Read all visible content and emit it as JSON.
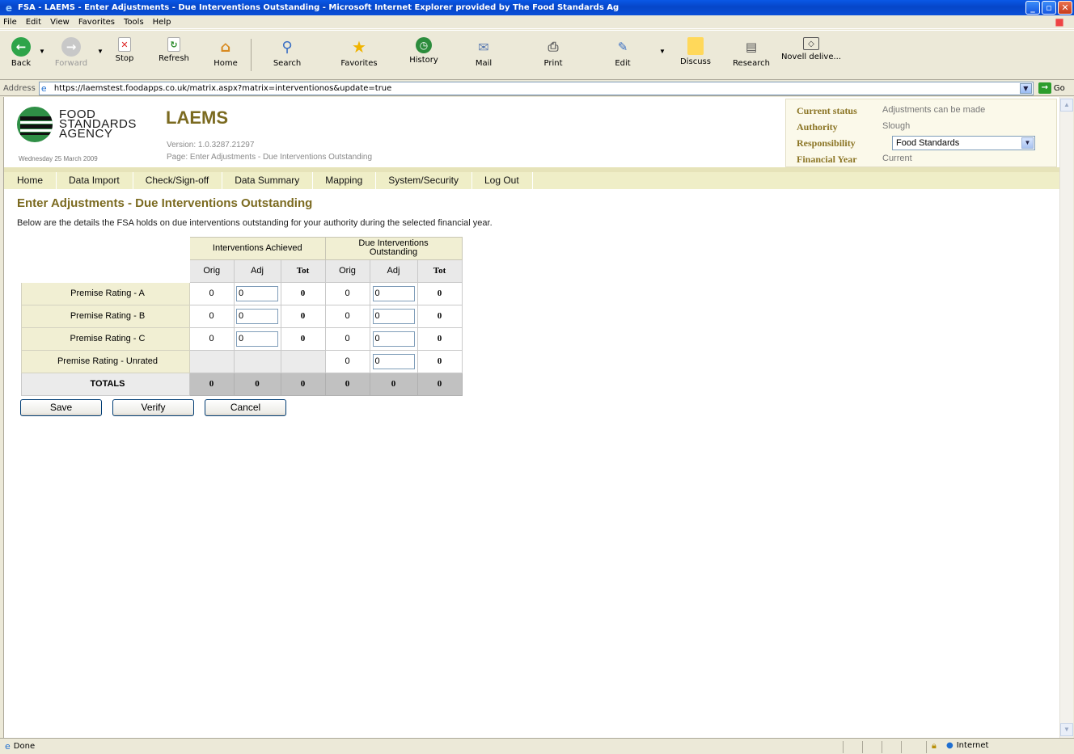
{
  "window": {
    "title": "FSA - LAEMS - Enter Adjustments - Due Interventions Outstanding - Microsoft Internet Explorer provided by The Food Standards Ag",
    "buttons": [
      "_",
      "▫",
      "✕"
    ]
  },
  "menu": [
    "File",
    "Edit",
    "View",
    "Favorites",
    "Tools",
    "Help"
  ],
  "toolbar": {
    "back": "Back",
    "forward": "Forward",
    "stop": "Stop",
    "refresh": "Refresh",
    "home": "Home",
    "search": "Search",
    "favorites": "Favorites",
    "history": "History",
    "mail": "Mail",
    "print": "Print",
    "edit": "Edit",
    "discuss": "Discuss",
    "research": "Research",
    "novell": "Novell delive..."
  },
  "address": {
    "label": "Address",
    "url": "https://laemstest.foodapps.co.uk/matrix.aspx?matrix=interventionos&update=true",
    "go": "Go"
  },
  "header": {
    "logo_line1": "FOOD",
    "logo_line2": "STANDARDS",
    "logo_line3": "AGENCY",
    "date": "Wednesday 25 March 2009",
    "app_title": "LAEMS",
    "version": "Version: 1.0.3287.21297",
    "page": "Page: Enter Adjustments - Due Interventions Outstanding"
  },
  "status": {
    "current_status_label": "Current status",
    "current_status": "Adjustments can be made",
    "authority_label": "Authority",
    "authority": "Slough",
    "responsibility_label": "Responsibility",
    "responsibility": "Food Standards",
    "financial_year_label": "Financial Year",
    "financial_year": "Current"
  },
  "nav": [
    "Home",
    "Data Import",
    "Check/Sign-off",
    "Data Summary",
    "Mapping",
    "System/Security",
    "Log Out"
  ],
  "content": {
    "heading": "Enter Adjustments - Due Interventions Outstanding",
    "intro": "Below are the details the FSA holds on due interventions outstanding for your authority during the selected financial year."
  },
  "table": {
    "group1": "Interventions Achieved",
    "group2_line1": "Due Interventions",
    "group2_line2": "Outstanding",
    "sub": [
      "Orig",
      "Adj",
      "Tot",
      "Orig",
      "Adj",
      "Tot"
    ],
    "rows": [
      {
        "label": "Premise Rating - A",
        "a_orig": "0",
        "a_adj": "0",
        "a_tot": "0",
        "d_orig": "0",
        "d_adj": "0",
        "d_tot": "0"
      },
      {
        "label": "Premise Rating - B",
        "a_orig": "0",
        "a_adj": "0",
        "a_tot": "0",
        "d_orig": "0",
        "d_adj": "0",
        "d_tot": "0"
      },
      {
        "label": "Premise Rating - C",
        "a_orig": "0",
        "a_adj": "0",
        "a_tot": "0",
        "d_orig": "0",
        "d_adj": "0",
        "d_tot": "0"
      },
      {
        "label": "Premise Rating - Unrated",
        "d_orig": "0",
        "d_adj": "0",
        "d_tot": "0"
      }
    ],
    "totals_label": "TOTALS",
    "totals": [
      "0",
      "0",
      "0",
      "0",
      "0",
      "0"
    ]
  },
  "buttons": {
    "save": "Save",
    "verify": "Verify",
    "cancel": "Cancel"
  },
  "statusbar": {
    "left": "Done",
    "zone": "Internet"
  }
}
